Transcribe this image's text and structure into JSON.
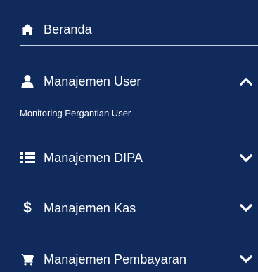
{
  "nav": {
    "items": [
      {
        "label": "Beranda",
        "icon": "home-icon"
      },
      {
        "label": "Manajemen User",
        "icon": "user-icon",
        "expanded": true
      },
      {
        "label": "Manajemen DIPA",
        "icon": "list-icon",
        "expanded": false
      },
      {
        "label": "Manajemen Kas",
        "icon": "dollar-icon",
        "expanded": false
      },
      {
        "label": "Manajemen Pembayaran",
        "icon": "cart-icon",
        "expanded": false
      }
    ],
    "submenu_user": [
      {
        "label": "Monitoring Pergantian User"
      }
    ]
  },
  "colors": {
    "background": "#0f2a5b",
    "text": "#ffffff",
    "divider": "#c9d2e3"
  }
}
